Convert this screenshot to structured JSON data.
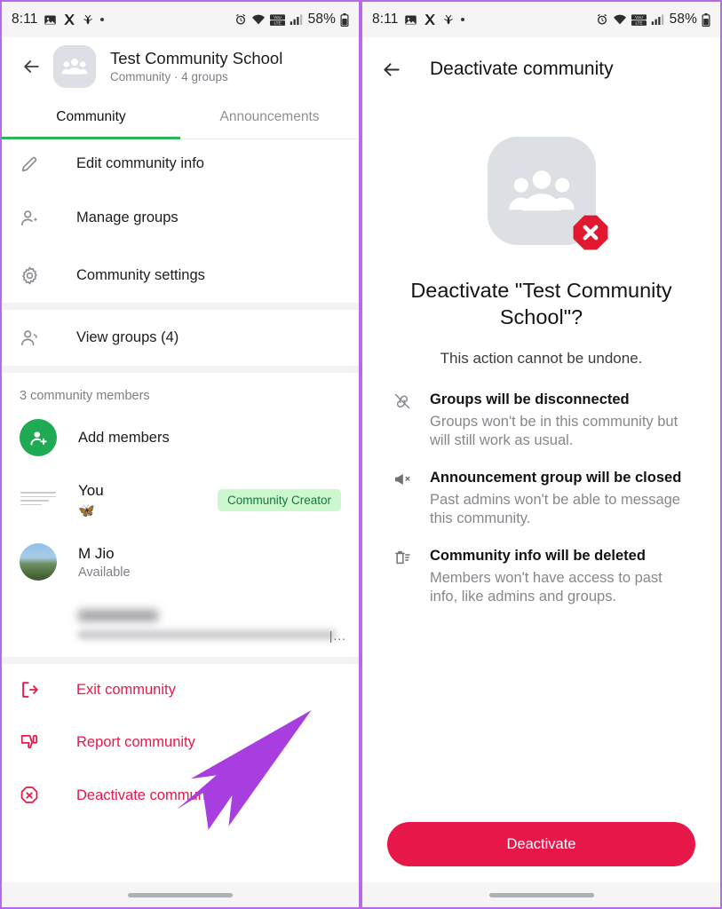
{
  "status_bar": {
    "time": "8:11",
    "left_icons": [
      "image-icon",
      "x-app-icon",
      "mosquito-icon",
      "dot-icon"
    ],
    "right_icons": [
      "alarm-icon",
      "wifi-icon",
      "volte-icon",
      "signal-icon"
    ],
    "battery_percent": "58%"
  },
  "left_screen": {
    "appbar": {
      "back": "back-arrow",
      "title": "Test Community School",
      "subtitle": "Community · 4 groups",
      "avatar": "community-avatar"
    },
    "tabs": [
      {
        "label": "Community",
        "active": true
      },
      {
        "label": "Announcements",
        "active": false
      }
    ],
    "menu_items": [
      {
        "label": "Edit community info",
        "icon": "pencil-icon"
      },
      {
        "label": "Manage groups",
        "icon": "manage-groups-icon"
      },
      {
        "label": "Community settings",
        "icon": "gear-icon"
      }
    ],
    "view_groups": {
      "label": "View groups (4)",
      "icon": "groups-icon"
    },
    "members_header": "3 community members",
    "add_members": {
      "label": "Add members",
      "icon": "add-person-icon"
    },
    "members": [
      {
        "name": "You",
        "status": "",
        "emoji": "🦋",
        "badge": "Community Creator",
        "avatar": "document-thumbnail"
      },
      {
        "name": "M Jio",
        "status": "Available",
        "emoji": "",
        "badge": "",
        "avatar": "scenery-photo"
      },
      {
        "name": "",
        "status": "",
        "emoji": "",
        "badge": "",
        "avatar": "blurred-photo",
        "redacted": true
      }
    ],
    "danger_actions": [
      {
        "label": "Exit community",
        "icon": "exit-icon"
      },
      {
        "label": "Report community",
        "icon": "thumbs-down-icon"
      },
      {
        "label": "Deactivate community",
        "icon": "octagon-x-icon"
      }
    ]
  },
  "right_screen": {
    "appbar": {
      "back": "back-arrow",
      "title": "Deactivate community"
    },
    "avatar": "community-avatar-with-x-badge",
    "title": "Deactivate \"Test Community School\"?",
    "subtitle": "This action cannot be undone.",
    "bullets": [
      {
        "icon": "broken-link-icon",
        "title": "Groups will be disconnected",
        "desc": "Groups won't be in this community but will still work as usual."
      },
      {
        "icon": "megaphone-mute-icon",
        "title": "Announcement group will be closed",
        "desc": "Past admins won't be able to message this community."
      },
      {
        "icon": "trash-list-icon",
        "title": "Community info will be deleted",
        "desc": "Members won't have access to past info, like admins and groups."
      }
    ],
    "deactivate_button": "Deactivate"
  },
  "colors": {
    "accent_green": "#2ab558",
    "danger_red": "#e8174a",
    "badge_green_bg": "#cdf7ce",
    "badge_green_text": "#117a38",
    "annotation_purple": "#a83de0",
    "avatar_grey": "#dcdfe3",
    "status_bar_bg": "#f5f5f6"
  },
  "annotations": [
    {
      "name": "arrow-to-deactivate-community",
      "color": "#a83de0"
    },
    {
      "name": "arrow-to-deactivate-button",
      "color": "#a83de0"
    }
  ]
}
